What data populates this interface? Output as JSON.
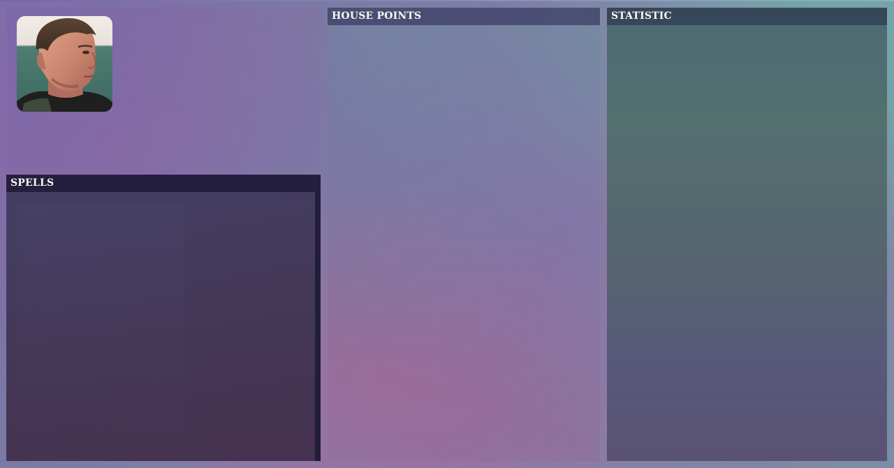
{
  "panels": {
    "spells": {
      "title": "SPELLS"
    },
    "house_points": {
      "title": "HOUSE POINTS"
    },
    "statistic": {
      "title": "STATISTIC"
    }
  },
  "profile": {
    "avatar": "character-portrait"
  }
}
